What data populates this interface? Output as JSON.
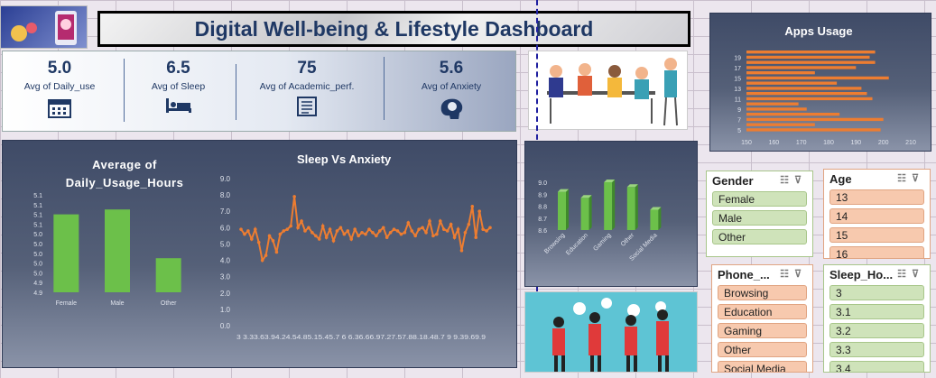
{
  "title": "Digital Well-being & Lifestyle Dashboard",
  "kpis": [
    {
      "value": "5.0",
      "label": "Avg of Daily_use",
      "icon": "calendar-icon"
    },
    {
      "value": "6.5",
      "label": "Avg of Sleep",
      "icon": "bed-icon"
    },
    {
      "value": "75",
      "label": "Avg of Academic_perf.",
      "icon": "report-icon"
    },
    {
      "value": "5.6",
      "label": "Avg of Anxiety",
      "icon": "brain-icon"
    }
  ],
  "colors": {
    "accent_green": "#6cc04a",
    "accent_orange": "#ed7d31",
    "title_blue": "#1f3864"
  },
  "chart_data": [
    {
      "type": "bar",
      "title": "Average of Daily_Usage_Hours",
      "categories": [
        "Female",
        "Male",
        "Other"
      ],
      "values": [
        5.06,
        5.07,
        4.97
      ],
      "ylim": [
        4.9,
        5.1
      ],
      "yticks": [
        "4.9",
        "4.9",
        "5.0",
        "5.0",
        "5.0",
        "5.0",
        "5.0",
        "5.1",
        "5.1",
        "5.1",
        "5.1"
      ],
      "grid": false
    },
    {
      "type": "line",
      "title": "Sleep Vs Anxiety",
      "ylim": [
        0,
        9
      ],
      "yticks": [
        "0.0",
        "1.0",
        "2.0",
        "3.0",
        "4.0",
        "5.0",
        "6.0",
        "7.0",
        "8.0",
        "9.0"
      ],
      "xtick_text": "3 3.33.63.94.24.54.85.15.45.7 6 6.36.66.97.27.57.88.18.48.7 9 9.39.69.9",
      "x": [
        3.0,
        3.1,
        3.2,
        3.3,
        3.4,
        3.5,
        3.6,
        3.7,
        3.8,
        3.9,
        4.0,
        4.1,
        4.2,
        4.3,
        4.4,
        4.5,
        4.6,
        4.7,
        4.8,
        4.9,
        5.0,
        5.1,
        5.2,
        5.3,
        5.4,
        5.5,
        5.6,
        5.7,
        5.8,
        5.9,
        6.0,
        6.1,
        6.2,
        6.3,
        6.4,
        6.5,
        6.6,
        6.7,
        6.8,
        6.9,
        7.0,
        7.1,
        7.2,
        7.3,
        7.4,
        7.5,
        7.6,
        7.7,
        7.8,
        7.9,
        8.0,
        8.1,
        8.2,
        8.3,
        8.4,
        8.5,
        8.6,
        8.7,
        8.8,
        8.9,
        9.0,
        9.1,
        9.2,
        9.3,
        9.4,
        9.5,
        9.6,
        9.7,
        9.8,
        9.9,
        10.0
      ],
      "y": [
        5.9,
        5.6,
        5.8,
        5.3,
        5.9,
        5.1,
        4.0,
        4.3,
        5.5,
        5.2,
        4.5,
        5.6,
        5.8,
        5.9,
        6.1,
        7.9,
        6.0,
        6.4,
        5.8,
        6.0,
        5.7,
        5.5,
        5.3,
        6.1,
        5.4,
        5.9,
        5.2,
        5.8,
        6.0,
        5.6,
        5.8,
        5.3,
        5.9,
        5.5,
        5.7,
        5.6,
        5.9,
        5.7,
        5.5,
        5.8,
        6.0,
        5.4,
        5.7,
        5.9,
        5.8,
        5.6,
        5.7,
        6.3,
        5.8,
        5.5,
        5.9,
        6.0,
        5.7,
        6.4,
        5.5,
        5.6,
        6.4,
        5.9,
        5.8,
        6.2,
        5.4,
        5.9,
        4.6,
        5.7,
        6.2,
        7.3,
        5.4,
        7.0,
        5.9,
        5.8,
        6.0
      ]
    },
    {
      "type": "bar",
      "title": "",
      "categories": [
        "Browsing",
        "Education",
        "Gaming",
        "Other",
        "Social Media"
      ],
      "values": [
        8.92,
        8.87,
        9.0,
        8.96,
        8.77
      ],
      "ylim": [
        8.6,
        9.0
      ],
      "yticks": [
        "8.6",
        "8.7",
        "8.8",
        "8.9",
        "9.0"
      ]
    },
    {
      "type": "bar",
      "title": "Apps Usage",
      "orientation": "horizontal",
      "categories": [
        "5",
        "6",
        "7",
        "8",
        "9",
        "10",
        "11",
        "12",
        "13",
        "14",
        "15",
        "16",
        "17",
        "18",
        "19",
        "20"
      ],
      "values": [
        199,
        175,
        200,
        184,
        172,
        169,
        196,
        194,
        192,
        183,
        202,
        175,
        190,
        197,
        195,
        197
      ],
      "xlim": [
        150,
        210
      ],
      "xticks": [
        "150",
        "160",
        "170",
        "180",
        "190",
        "200",
        "210"
      ],
      "ytick_labels": [
        "5",
        "7",
        "9",
        "11",
        "13",
        "15",
        "17",
        "19"
      ]
    }
  ],
  "slicers": {
    "gender": {
      "title": "Gender",
      "items": [
        "Female",
        "Male",
        "Other"
      ]
    },
    "age": {
      "title": "Age",
      "items": [
        "13",
        "14",
        "15",
        "16"
      ]
    },
    "phone": {
      "title": "Phone_...",
      "items": [
        "Browsing",
        "Education",
        "Gaming",
        "Other",
        "Social Media"
      ]
    },
    "sleep": {
      "title": "Sleep_Ho...",
      "items": [
        "3",
        "3.1",
        "3.2",
        "3.3",
        "3.4"
      ]
    }
  }
}
